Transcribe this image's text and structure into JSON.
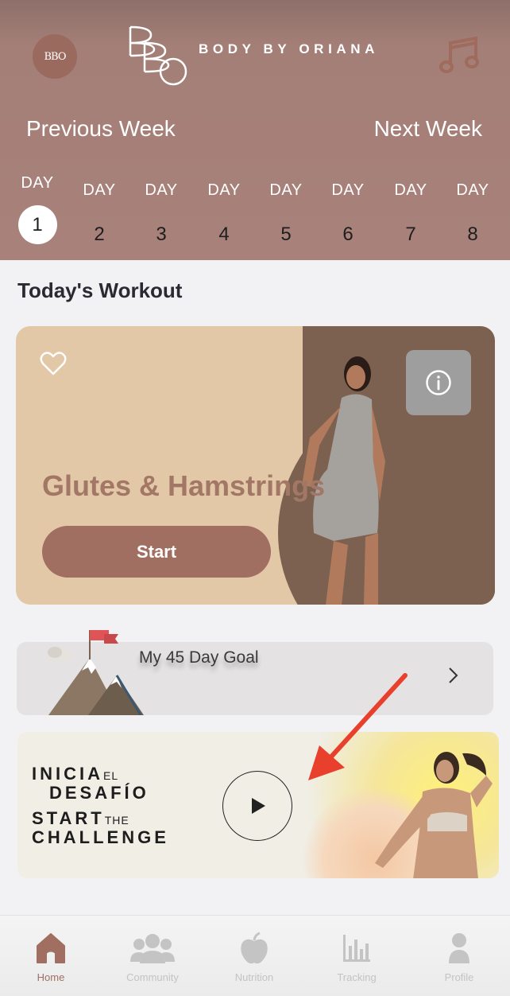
{
  "header": {
    "avatar_monogram": "BBO",
    "brand_name": "BODY BY ORIANA",
    "previous_week": "Previous Week",
    "next_week": "Next Week",
    "day_label": "DAY",
    "days": [
      "1",
      "2",
      "3",
      "4",
      "5",
      "6",
      "7",
      "8"
    ],
    "selected_day": "1"
  },
  "main": {
    "section_title": "Today's Workout",
    "workout": {
      "title": "Glutes & Hamstrings",
      "start_label": "Start"
    },
    "goal": {
      "label": "My 45 Day Goal"
    },
    "challenge": {
      "line1_big": "INICIA",
      "line1_small": "EL",
      "line2_big": "DESAFÍO",
      "line3_big": "START",
      "line3_small": "THE",
      "line4_big": "CHALLENGE"
    }
  },
  "tabbar": {
    "items": [
      {
        "label": "Home",
        "icon": "home-icon",
        "active": true
      },
      {
        "label": "Community",
        "icon": "community-icon",
        "active": false
      },
      {
        "label": "Nutrition",
        "icon": "apple-icon",
        "active": false
      },
      {
        "label": "Tracking",
        "icon": "chart-icon",
        "active": false
      },
      {
        "label": "Profile",
        "icon": "profile-icon",
        "active": false
      }
    ]
  },
  "colors": {
    "header_bg": "#a8827a",
    "accent": "#a06f62",
    "workout_card_bg": "#e3c8a8",
    "workout_card_dark": "#7c6150",
    "arrow": "#e8402c"
  }
}
